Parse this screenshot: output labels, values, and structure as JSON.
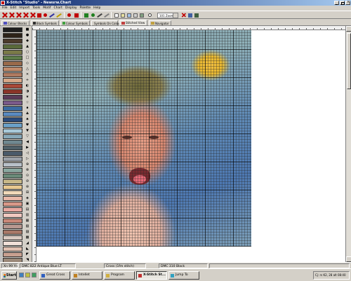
{
  "window": {
    "title": "X-Stitch \"Studio\" - Newsrw.Chart"
  },
  "menu": [
    "File",
    "Edit",
    "Import",
    "Tools",
    "Motif",
    "Chart",
    "Display",
    "Palette",
    "Help"
  ],
  "toolbar": {
    "zoom_value": "101 Zoom"
  },
  "tabs": [
    {
      "label": "Colour Blocks",
      "icon": "colour-blocks-icon",
      "color": "#5050c0"
    },
    {
      "label": "Black Symbols",
      "icon": "black-symbols-icon",
      "color": "#303030"
    },
    {
      "label": "Colour Symbols",
      "icon": "colour-symbols-icon",
      "color": "#40a040"
    },
    {
      "label": "Symbols On Colour",
      "icon": "symbols-on-colour-icon",
      "color": "#20a0c0"
    },
    {
      "label": "Stitched View",
      "icon": "stitched-view-icon",
      "color": "#c04040"
    },
    {
      "label": "Navigator",
      "icon": "navigator-icon",
      "color": "#c0a040"
    }
  ],
  "palette": {
    "swatches": [
      "#1e1e1e",
      "#2c2218",
      "#4b3a2a",
      "#5a6a3a",
      "#7a7a48",
      "#5e7c4a",
      "#9a6a4a",
      "#c08a6a",
      "#b07a60",
      "#d8a888",
      "#a84838",
      "#8a3428",
      "#5a3a58",
      "#7a5a8a",
      "#3a6aa0",
      "#5a8ac0",
      "#2a4a7a",
      "#6aa0c8",
      "#a8c8d8",
      "#88a8b8",
      "#708890",
      "#506068",
      "#4a5a6a",
      "#9aa0a8",
      "#b8c0c8",
      "#8aa8a0",
      "#6a8a78",
      "#c8b888",
      "#e8c890",
      "#f0d8b8",
      "#e8b8a8",
      "#d89888",
      "#e8a8a0",
      "#f0c8c0",
      "#c88878",
      "#b89890",
      "#a87868",
      "#d8c8c0",
      "#f0e0d8",
      "#e0c0b0",
      "#c8a090",
      "#9a8878",
      "#7a6858",
      "#f0d0c8"
    ],
    "symbols": [
      "■",
      "●",
      "◆",
      "▲",
      "○",
      "□",
      "◇",
      "△",
      "✕",
      "+",
      "◐",
      "◑",
      "★",
      "☆",
      "♦",
      "♣",
      "♠",
      "♥",
      "▼",
      "▽",
      "◀",
      "▶",
      "◁",
      "▷",
      "⊕",
      "⊗",
      "⊙",
      "⊘",
      "⊛",
      "⊞",
      "◈",
      "▣",
      "▤",
      "▥",
      "▦",
      "▧",
      "▨",
      "▩",
      "◢",
      "◣",
      "◤",
      "◥",
      "╳",
      "⊠"
    ]
  },
  "status": {
    "position": "Xn 99 Yn 22",
    "dmc_thread": "DMC 822 Antique Blue LT",
    "stitch_type": "Cross (1fm stitch)",
    "dmc_selected": "DMC 310 Black"
  },
  "taskbar": {
    "start_label": "Start",
    "tasks": [
      {
        "label": "Great Cross",
        "color": "#3060c0"
      },
      {
        "label": "Intellet",
        "color": "#c08020"
      },
      {
        "label": "Program",
        "color": "#d0b040"
      },
      {
        "label": "X-Stitch St...",
        "color": "#c03030"
      },
      {
        "label": "Jump To",
        "color": "#30a0c0"
      }
    ],
    "tray_text": "Cj: rs K2, 28 alt 08:40"
  }
}
